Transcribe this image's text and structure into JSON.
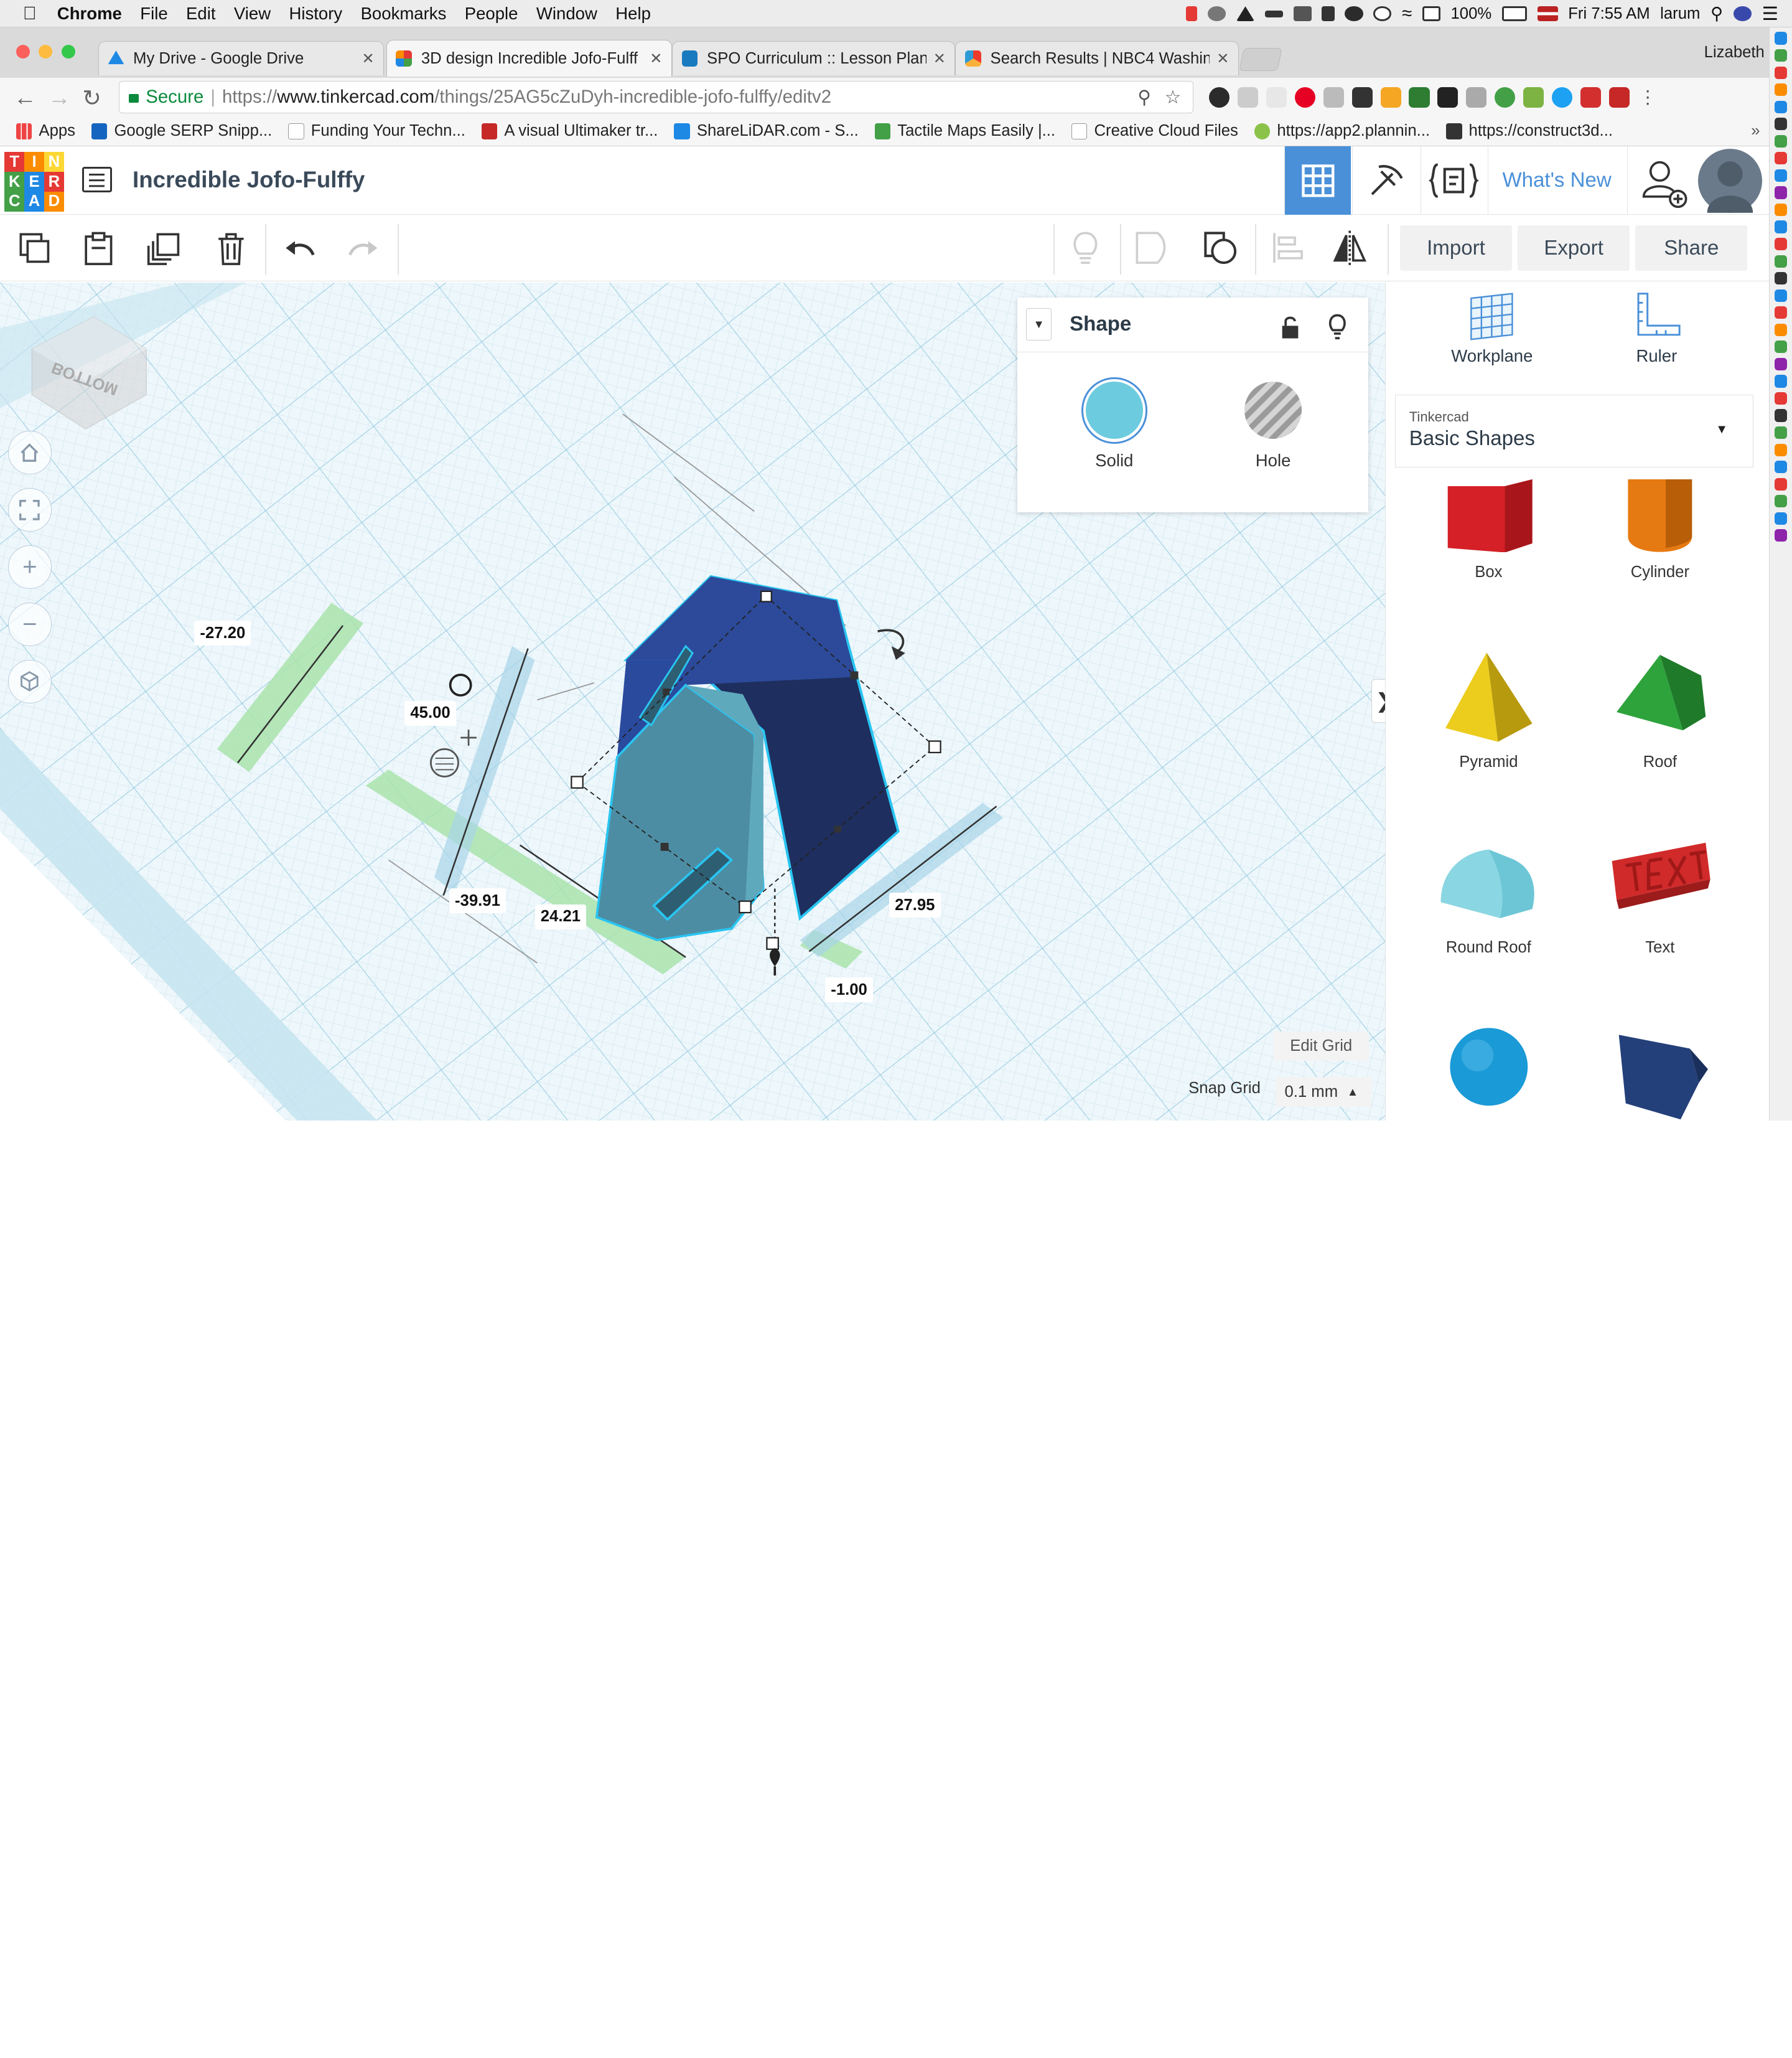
{
  "menubar": {
    "app": "Chrome",
    "items": [
      "File",
      "Edit",
      "View",
      "History",
      "Bookmarks",
      "People",
      "Window",
      "Help"
    ],
    "battery": "100%",
    "clock": "Fri 7:55 AM",
    "user": "larum"
  },
  "browser": {
    "tabs": [
      {
        "title": "My Drive - Google Drive",
        "favicon_color": "#1e88e5"
      },
      {
        "title": "3D design Incredible Jofo-Fulff",
        "favicon_color": "#e94b3c"
      },
      {
        "title": "SPO Curriculum :: Lesson Plan",
        "favicon_color": "#1a7abf"
      },
      {
        "title": "Search Results | NBC4 Washin",
        "favicon_color": "#ee3a2c"
      }
    ],
    "profile_name": "Lizabeth",
    "secure_label": "Secure",
    "url_prefix": "https://",
    "url_host": "www.tinkercad.com",
    "url_path": "/things/25AG5cZuDyh-incredible-jofo-fulffy/editv2"
  },
  "bookmarks": [
    {
      "label": "Apps",
      "color": "#e44"
    },
    {
      "label": "Google SERP Snipp...",
      "color": "#1565c0"
    },
    {
      "label": "Funding Your Techn...",
      "color": "#999"
    },
    {
      "label": "A visual Ultimaker tr...",
      "color": "#c62828"
    },
    {
      "label": "ShareLiDAR.com - S...",
      "color": "#1e88e5"
    },
    {
      "label": "Tactile Maps Easily |...",
      "color": "#43a047"
    },
    {
      "label": "Creative Cloud Files",
      "color": "#999"
    },
    {
      "label": "https://app2.plannin...",
      "color": "#8bc34a"
    },
    {
      "label": "https://construct3d...",
      "color": "#333"
    }
  ],
  "tinkercad": {
    "logo_letters": [
      "T",
      "I",
      "N",
      "K",
      "E",
      "R",
      "C",
      "A",
      "D"
    ],
    "logo_colors": [
      "#e53935",
      "#fb8c00",
      "#fdd835",
      "#43a047",
      "#1e88e5",
      "#e53935",
      "#43a047",
      "#1e88e5",
      "#fb8c00"
    ],
    "design_title": "Incredible Jofo-Fulffy",
    "whats_new": "What's New",
    "buttons": {
      "import": "Import",
      "export": "Export",
      "share": "Share"
    }
  },
  "shape_panel": {
    "title": "Shape",
    "solid_label": "Solid",
    "hole_label": "Hole",
    "solid_color": "#6ccbde"
  },
  "right_panel": {
    "workplane_label": "Workplane",
    "ruler_label": "Ruler",
    "library_source": "Tinkercad",
    "library_name": "Basic Shapes",
    "shapes": [
      {
        "name": "Box",
        "color": "#d42026"
      },
      {
        "name": "Cylinder",
        "color": "#e67a12"
      },
      {
        "name": "Pyramid",
        "color": "#eccc1d"
      },
      {
        "name": "Roof",
        "color": "#2ea33c"
      },
      {
        "name": "Round Roof",
        "color": "#6cc6d6"
      },
      {
        "name": "Text",
        "color": "#d12a2a"
      },
      {
        "name": "Sphere",
        "color": "#1a9ad6"
      },
      {
        "name": "Wedge",
        "color": "#24407a"
      }
    ]
  },
  "canvas": {
    "dimensions": {
      "d1": "-27.20",
      "d2": "45.00",
      "d3": "-39.91",
      "d4": "24.21",
      "d5": "27.95",
      "d6": "-1.00"
    },
    "viewcube_label": "BOTTOM",
    "edit_grid": "Edit Grid",
    "snap_label": "Snap Grid",
    "snap_value": "0.1 mm"
  }
}
